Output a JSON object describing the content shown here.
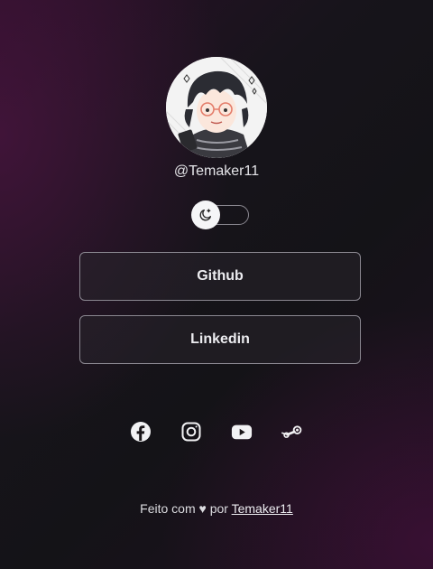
{
  "profile": {
    "username": "@Temaker11"
  },
  "theme_toggle": {
    "icon": "moon-icon"
  },
  "links": [
    {
      "label": "Github"
    },
    {
      "label": "Linkedin"
    }
  ],
  "socials": [
    {
      "icon": "facebook-icon"
    },
    {
      "icon": "instagram-icon"
    },
    {
      "icon": "youtube-icon"
    },
    {
      "icon": "steam-icon"
    }
  ],
  "footer": {
    "prefix": "Feito com",
    "heart": "♥",
    "por": "por",
    "author_link": "Temaker11"
  }
}
